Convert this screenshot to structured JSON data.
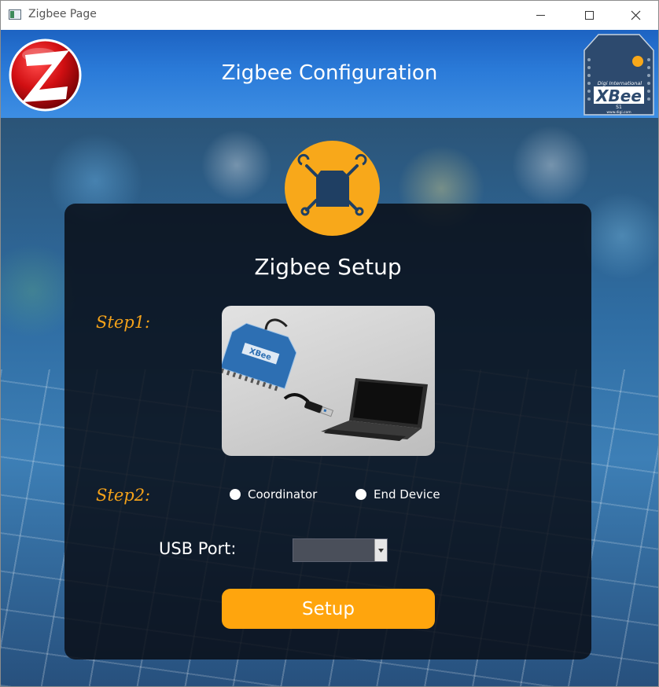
{
  "window": {
    "title": "Zigbee Page",
    "icons": [
      "window-app-icon",
      "minimize-icon",
      "maximize-icon",
      "close-icon"
    ]
  },
  "header": {
    "title": "Zigbee Configuration",
    "left_logo": "zigbee-logo",
    "right_logo": {
      "name": "xbee-module-logo",
      "brand": "Digi International",
      "product": "XBee",
      "model": "S1",
      "url": "www.digi.com"
    }
  },
  "setup": {
    "badge_icon": "module-tools-icon",
    "title": "Zigbee Setup",
    "step1_label": "Step1:",
    "step1_image": "xbee-module-usb-laptop-image",
    "step2_label": "Step2:",
    "options": [
      {
        "label": "Coordinator",
        "selected": false
      },
      {
        "label": "End Device",
        "selected": false
      }
    ],
    "usb_port": {
      "label": "USB Port:",
      "value": ""
    },
    "button_label": "Setup"
  },
  "colors": {
    "accent": "#ffa50d",
    "step_label": "#f4a21a",
    "header_blue": "#2a7ad8",
    "panel": "#080c14"
  }
}
